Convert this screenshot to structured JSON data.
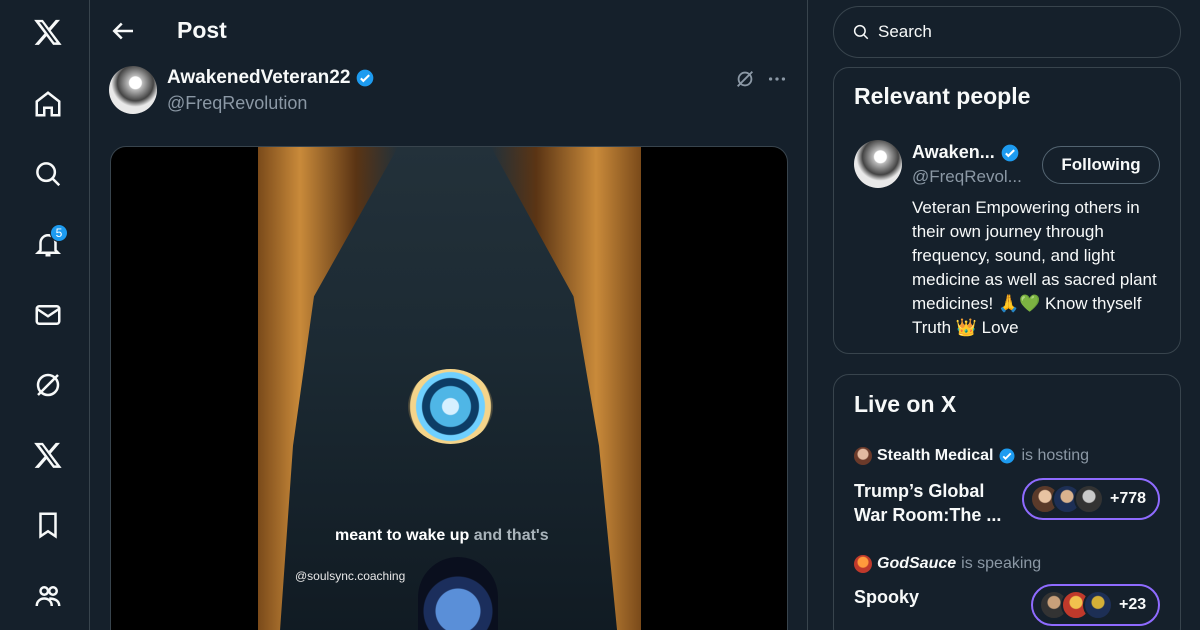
{
  "nav": {
    "notification_count": "5"
  },
  "header": {
    "title": "Post"
  },
  "post": {
    "author_name": "AwakenedVeteran22",
    "author_handle": "@FreqRevolution",
    "caption_main": "meant to wake up",
    "caption_dim": " and that's",
    "watermark": "@soulsync.coaching"
  },
  "search": {
    "placeholder": "Search"
  },
  "relevant": {
    "title": "Relevant people",
    "name": "Awaken...",
    "handle": "@FreqRevol...",
    "follow_label": "Following",
    "bio": "Veteran Empowering others in their own journey through frequency, sound, and light medicine as well as sacred plant medicines! 🙏💚 Know thyself Truth 👑 Love"
  },
  "live": {
    "title": "Live on X",
    "spaces": [
      {
        "host": "Stealth Medical",
        "status": "is hosting",
        "title": "Trump’s Global War Room:The ...",
        "count": "+778",
        "host_verified": true
      },
      {
        "host": "GodSauce",
        "status": "is speaking",
        "title": "Spooky",
        "count": "+23",
        "host_verified": false
      }
    ]
  },
  "colors": {
    "background": "#15202b",
    "border": "#38444d",
    "accent": "#1d9bf0",
    "muted": "#8b98a5",
    "space_ring": "#8f6bff"
  }
}
